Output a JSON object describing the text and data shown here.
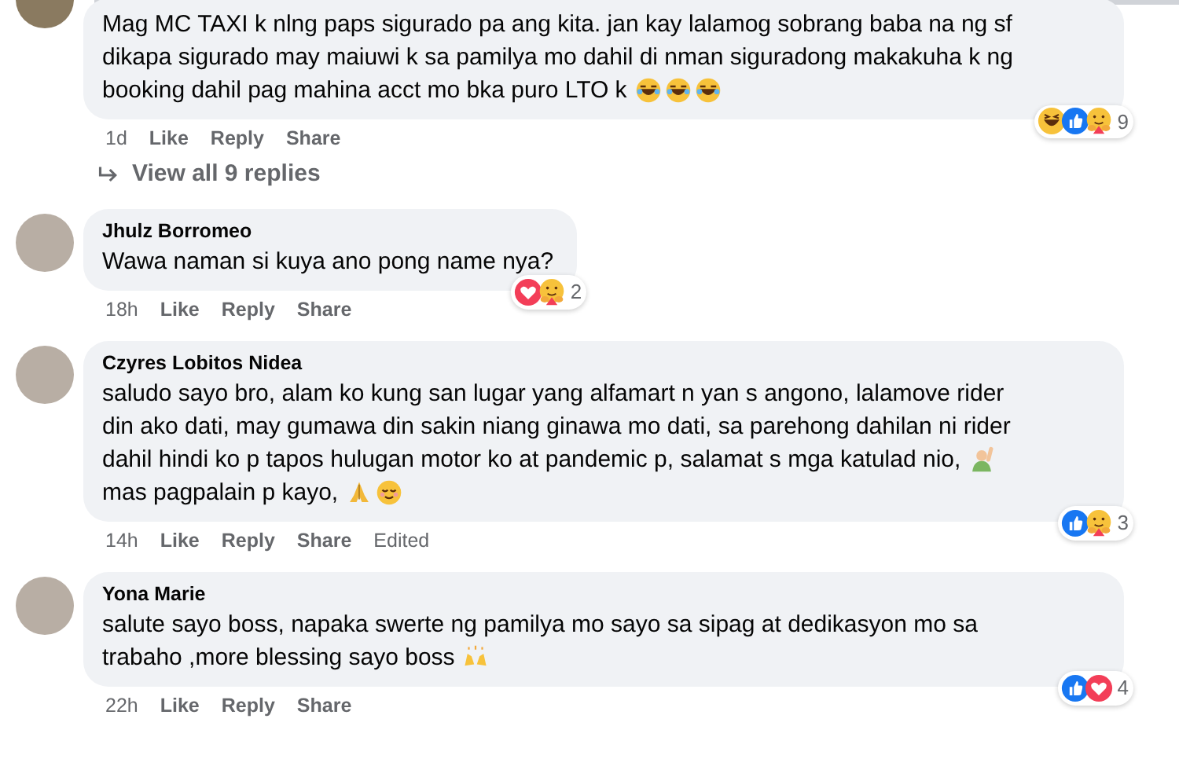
{
  "comments": [
    {
      "lines": [
        {
          "text": "Mag MC TAXI k nlng paps sigurado pa ang kita. jan kay lalamog sobrang baba na ng sf"
        },
        {
          "text": "dikapa sigurado may maiuwi k sa pamilya mo dahil di nman siguradong makakuha k ng"
        },
        {
          "text": "booking dahil pag mahina acct mo bka puro LTO k",
          "icons": [
            {
              "kind": "laugh"
            },
            {
              "kind": "laugh"
            },
            {
              "kind": "laugh"
            }
          ]
        }
      ],
      "time": "1d",
      "actions": [
        "Like",
        "Reply",
        "Share"
      ],
      "reactions": [
        {
          "kind": "haha"
        },
        {
          "kind": "like"
        },
        {
          "kind": "care"
        }
      ],
      "reaction_count": "9",
      "replies_link": "View all 9 replies"
    },
    {
      "author": "Jhulz Borromeo",
      "lines": [
        {
          "text": "Wawa naman si kuya ano pong name nya?"
        }
      ],
      "time": "18h",
      "actions": [
        "Like",
        "Reply",
        "Share"
      ],
      "reactions": [
        {
          "kind": "love"
        },
        {
          "kind": "care"
        }
      ],
      "reaction_count": "2"
    },
    {
      "author": "Czyres Lobitos Nidea",
      "lines": [
        {
          "text": "saludo sayo bro, alam ko kung san lugar yang alfamart n yan s angono, lalamove rider"
        },
        {
          "text": "din ako dati, may gumawa din sakin niang ginawa mo dati, sa parehong dahilan ni rider"
        },
        {
          "text": "dahil hindi ko p tapos hulugan motor ko at pandemic p, salamat s mga katulad nio,",
          "icons": [
            {
              "kind": "person"
            }
          ]
        },
        {
          "text": "mas pagpalain p kayo,",
          "icons": [
            {
              "kind": "pray"
            },
            {
              "kind": "relieved"
            }
          ]
        }
      ],
      "time": "14h",
      "actions": [
        "Like",
        "Reply",
        "Share"
      ],
      "edited": "Edited",
      "reactions": [
        {
          "kind": "like"
        },
        {
          "kind": "care"
        }
      ],
      "reaction_count": "3"
    },
    {
      "author": "Yona Marie",
      "lines": [
        {
          "text": "salute sayo boss, napaka swerte ng pamilya mo sayo sa sipag at dedikasyon mo sa"
        },
        {
          "text": "trabaho ,more blessing sayo boss",
          "icons": [
            {
              "kind": "hands"
            }
          ]
        }
      ],
      "time": "22h",
      "actions": [
        "Like",
        "Reply",
        "Share"
      ],
      "reactions": [
        {
          "kind": "like"
        },
        {
          "kind": "love"
        }
      ],
      "reaction_count": "4"
    }
  ]
}
